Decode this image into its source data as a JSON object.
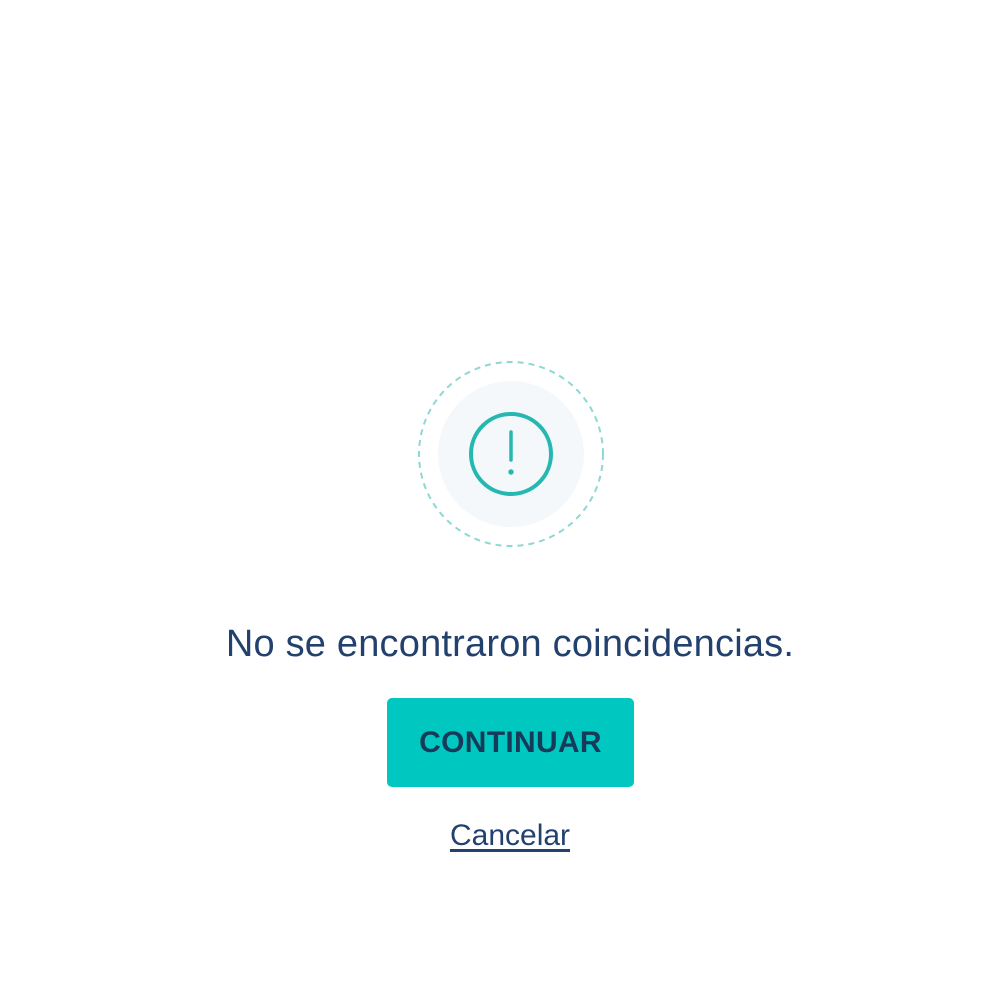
{
  "dialog": {
    "icon": "alert-circle-icon",
    "message": "No se encontraron coincidencias.",
    "continue_label": "CONTINUAR",
    "cancel_label": "Cancelar"
  },
  "colors": {
    "accent": "#00c7c0",
    "icon_stroke": "#25b8b1",
    "text": "#23416f",
    "icon_background": "#f4f8fb"
  }
}
